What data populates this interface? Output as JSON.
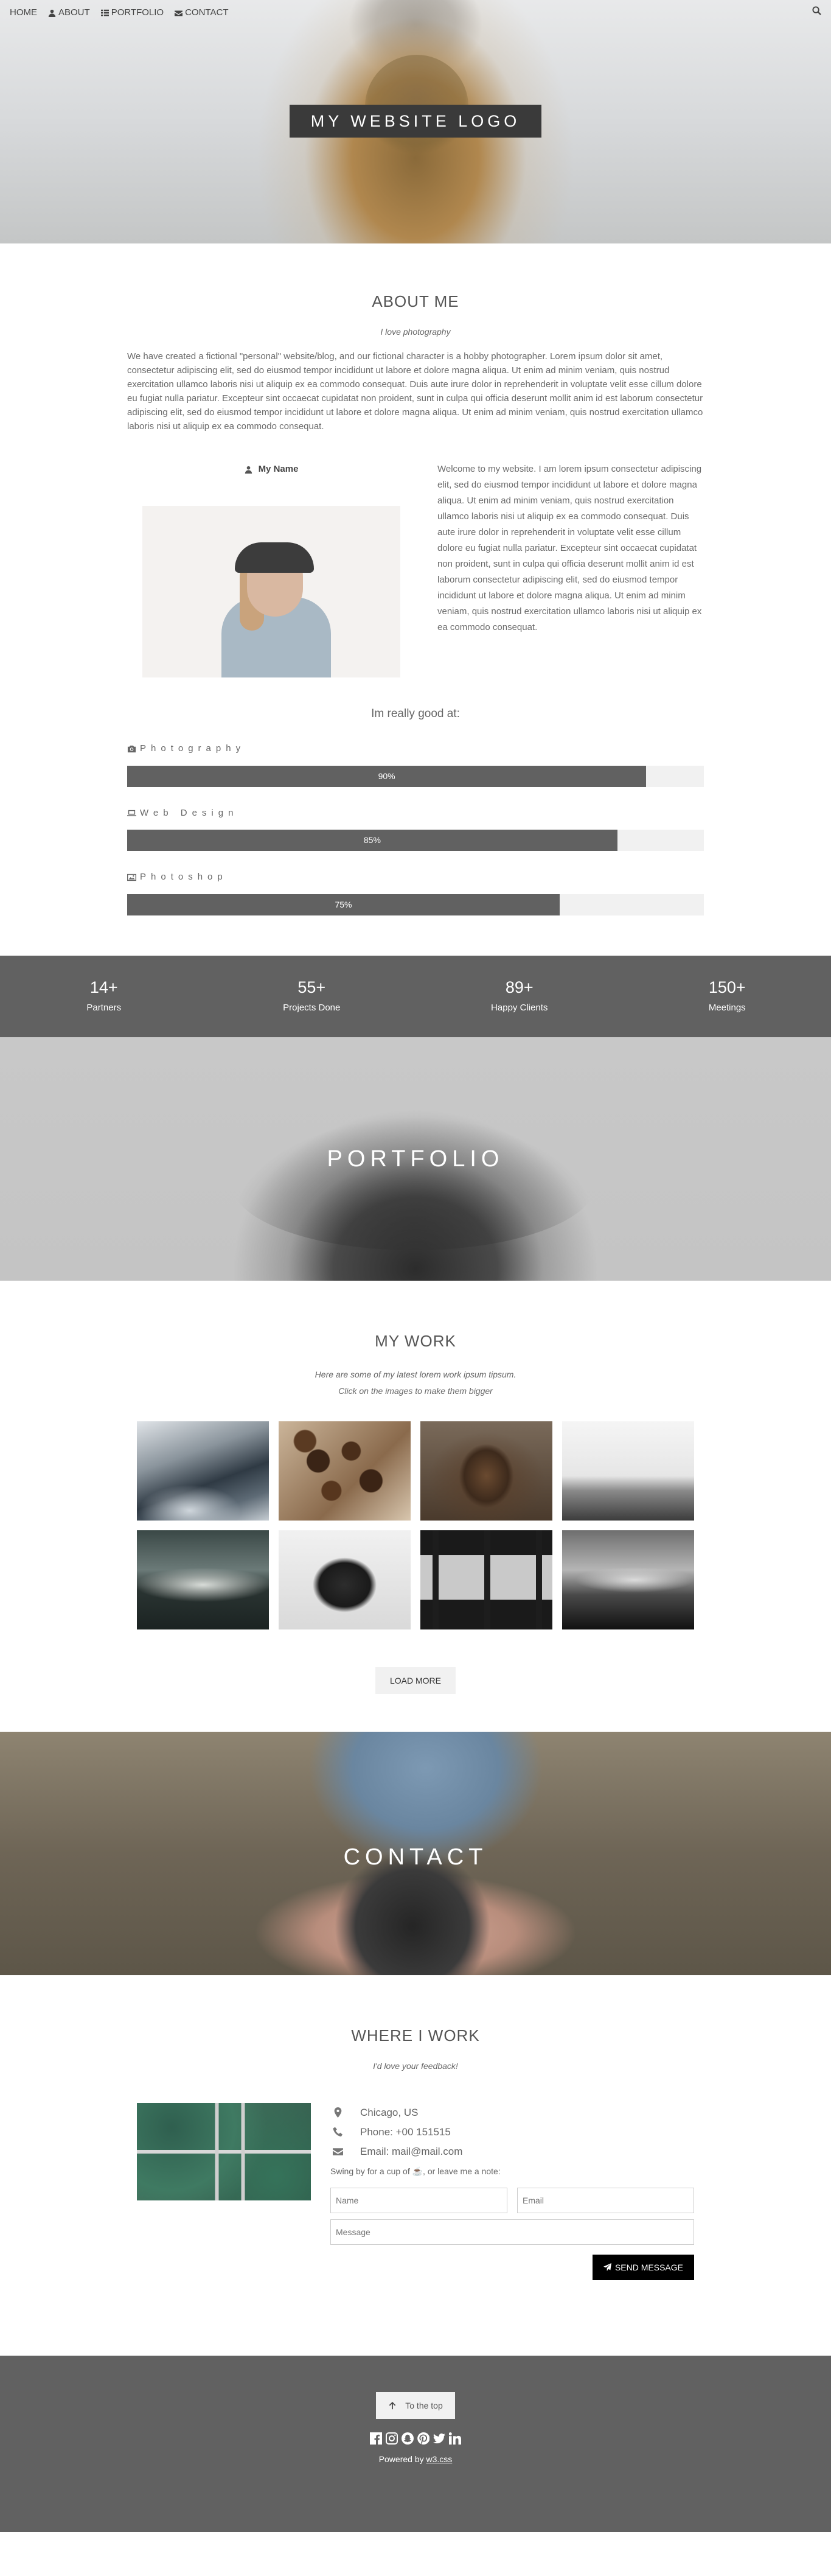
{
  "nav": {
    "items": [
      {
        "label": "HOME",
        "icon": ""
      },
      {
        "label": "ABOUT",
        "icon": "user-icon"
      },
      {
        "label": "PORTFOLIO",
        "icon": "th-icon"
      },
      {
        "label": "CONTACT",
        "icon": "envelope-icon"
      }
    ],
    "search_icon": "search-icon"
  },
  "hero": {
    "logo": "MY WEBSITE LOGO"
  },
  "about": {
    "title": "ABOUT ME",
    "subtitle": "I love photography",
    "paragraph": "We have created a fictional \"personal\" website/blog, and our fictional character is a hobby photographer. Lorem ipsum dolor sit amet, consectetur adipiscing elit, sed do eiusmod tempor incididunt ut labore et dolore magna aliqua. Ut enim ad minim veniam, quis nostrud exercitation ullamco laboris nisi ut aliquip ex ea commodo consequat. Duis aute irure dolor in reprehenderit in voluptate velit esse cillum dolore eu fugiat nulla pariatur. Excepteur sint occaecat cupidatat non proident, sunt in culpa qui officia deserunt mollit anim id est laborum consectetur adipiscing elit, sed do eiusmod tempor incididunt ut labore et dolore magna aliqua. Ut enim ad minim veniam, quis nostrud exercitation ullamco laboris nisi ut aliquip ex ea commodo consequat.",
    "name": "My Name",
    "welcome": "Welcome to my website. I am lorem ipsum consectetur adipiscing elit, sed do eiusmod tempor incididunt ut labore et dolore magna aliqua. Ut enim ad minim veniam, quis nostrud exercitation ullamco laboris nisi ut aliquip ex ea commodo consequat. Duis aute irure dolor in reprehenderit in voluptate velit esse cillum dolore eu fugiat nulla pariatur. Excepteur sint occaecat cupidatat non proident, sunt in culpa qui officia deserunt mollit anim id est laborum consectetur adipiscing elit, sed do eiusmod tempor incididunt ut labore et dolore magna aliqua. Ut enim ad minim veniam, quis nostrud exercitation ullamco laboris nisi ut aliquip ex ea commodo consequat.",
    "good_at": "Im really good at:",
    "skills": [
      {
        "label": "Photography",
        "icon": "camera-icon",
        "percent": 90,
        "percent_text": "90%"
      },
      {
        "label": "Web Design",
        "icon": "laptop-icon",
        "percent": 85,
        "percent_text": "85%"
      },
      {
        "label": "Photoshop",
        "icon": "photo-icon",
        "percent": 75,
        "percent_text": "75%"
      }
    ]
  },
  "stats": [
    {
      "num": "14+",
      "label": "Partners"
    },
    {
      "num": "55+",
      "label": "Projects Done"
    },
    {
      "num": "89+",
      "label": "Happy Clients"
    },
    {
      "num": "150+",
      "label": "Meetings"
    }
  ],
  "portfolio": {
    "hero_title": "PORTFOLIO",
    "title": "MY WORK",
    "subtitle_1": "Here are some of my latest lorem work ipsum tipsum.",
    "subtitle_2": "Click on the images to make them bigger",
    "images": [
      "mountains",
      "coffee-beans",
      "bear",
      "misty-sea",
      "foggy-forest",
      "typewriter",
      "tram-windows",
      "lake-mist"
    ],
    "load_more": "LOAD MORE"
  },
  "contact": {
    "hero_title": "CONTACT",
    "title": "WHERE I WORK",
    "subtitle": "I'd love your feedback!",
    "location": "Chicago, US",
    "phone": "Phone: +00 151515",
    "email": "Email: mail@mail.com",
    "swing": "Swing by for a cup of ☕, or leave me a note:",
    "name_placeholder": "Name",
    "email_placeholder": "Email",
    "message_placeholder": "Message",
    "send": "SEND MESSAGE"
  },
  "footer": {
    "to_top": "To the top",
    "powered_prefix": "Powered by ",
    "powered_link": "w3.css"
  }
}
